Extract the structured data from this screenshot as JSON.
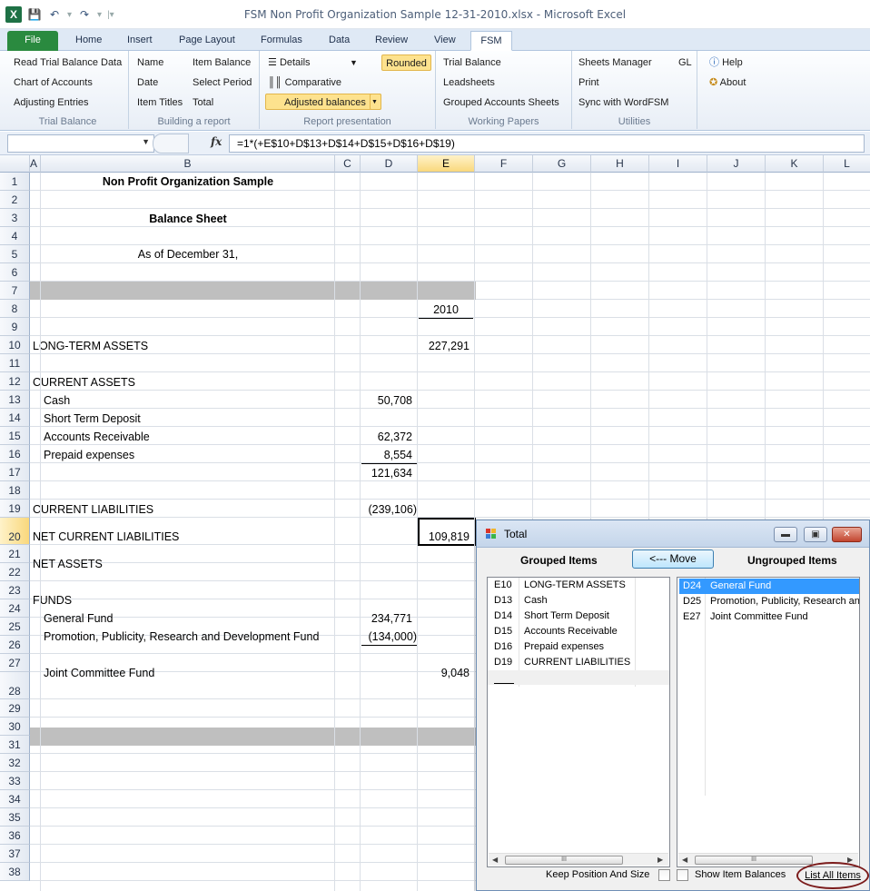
{
  "window": {
    "title": "FSM Non Profit Organization Sample 12-31-2010.xlsx  -  Microsoft Excel",
    "app_icon": "X"
  },
  "qat": {
    "save_icon": "save-icon",
    "undo_icon": "undo-icon",
    "redo_icon": "redo-icon"
  },
  "tabs": [
    "File",
    "Home",
    "Insert",
    "Page Layout",
    "Formulas",
    "Data",
    "Review",
    "View",
    "FSM"
  ],
  "ribbon": {
    "trial_balance": {
      "items": [
        "Read Trial Balance Data",
        "Chart of Accounts",
        "Adjusting Entries"
      ],
      "label": "Trial Balance"
    },
    "building": {
      "col1": [
        "Name",
        "Date",
        "Item Titles"
      ],
      "col2": [
        "Item Balance",
        "Select Period",
        "Total"
      ],
      "label": "Building a report"
    },
    "presentation": {
      "details": "Details",
      "comparative": "Comparative",
      "adjusted": "Adjusted balances",
      "rounded": "Rounded",
      "label": "Report presentation"
    },
    "working": {
      "items": [
        "Trial Balance",
        "Leadsheets",
        "Grouped Accounts Sheets"
      ],
      "label": "Working Papers"
    },
    "utilities": {
      "items": [
        "Sheets Manager",
        "Print",
        "Sync with WordFSM"
      ],
      "gl": "GL",
      "label": "Utilities"
    },
    "help": {
      "help": "Help",
      "about": "About"
    }
  },
  "formula_bar": {
    "name_box": "",
    "fx": "fx",
    "formula": "=1*(+E$10+D$13+D$14+D$15+D$16+D$19)"
  },
  "columns": [
    "A",
    "B",
    "C",
    "D",
    "E",
    "F",
    "G",
    "H",
    "I",
    "J",
    "K",
    "L"
  ],
  "rows": [
    "1",
    "2",
    "3",
    "4",
    "5",
    "6",
    "7",
    "8",
    "9",
    "10",
    "11",
    "12",
    "13",
    "14",
    "15",
    "16",
    "17",
    "18",
    "19",
    "20",
    "21",
    "22",
    "23",
    "24",
    "25",
    "26",
    "27",
    "28",
    "29",
    "30",
    "31",
    "32",
    "33",
    "34",
    "35",
    "36",
    "37",
    "38"
  ],
  "sheet": {
    "title": "Non Profit Organization Sample",
    "subtitle": "Balance Sheet",
    "date_line": "As of December 31,",
    "year": "2010",
    "long_term_assets": "LONG-TERM ASSETS",
    "long_term_assets_value": "227,291",
    "current_assets": "CURRENT ASSETS",
    "cash": "Cash",
    "cash_value": "50,708",
    "short_term_deposit": "Short Term Deposit",
    "accounts_receivable": "Accounts Receivable",
    "accounts_receivable_value": "62,372",
    "prepaid": "Prepaid expenses",
    "prepaid_value": "8,554",
    "current_total": "121,634",
    "current_liabilities": "CURRENT LIABILITIES",
    "current_liabilities_value": "(239,106)",
    "net_current_liabilities": "NET CURRENT LIABILITIES",
    "net_current_liabilities_value": "109,819",
    "net_assets": "NET ASSETS",
    "funds": "FUNDS",
    "general_fund": "General Fund",
    "general_fund_value": "234,771",
    "promotion_fund": "Promotion, Publicity, Research and Development Fund",
    "promotion_fund_value": "(134,000)",
    "joint_fund": "Joint Committee Fund",
    "joint_fund_value": "9,048"
  },
  "dialog": {
    "title": "Total",
    "grouped_label": "Grouped Items",
    "ungrouped_label": "Ungrouped Items",
    "move": "<--- Move",
    "grouped": [
      {
        "ref": "E10",
        "name": "LONG-TERM ASSETS"
      },
      {
        "ref": "D13",
        "name": "Cash"
      },
      {
        "ref": "D14",
        "name": "Short Term Deposit"
      },
      {
        "ref": "D15",
        "name": "Accounts Receivable"
      },
      {
        "ref": "D16",
        "name": "Prepaid expenses"
      },
      {
        "ref": "D19",
        "name": "CURRENT LIABILITIES"
      }
    ],
    "ungrouped": [
      {
        "ref": "D24",
        "name": "General Fund"
      },
      {
        "ref": "D25",
        "name": "Promotion, Publicity, Research and"
      },
      {
        "ref": "E27",
        "name": "Joint Committee Fund"
      }
    ],
    "scroll_thumb": "III",
    "keep_position": "Keep Position And Size",
    "show_balances": "Show Item Balances",
    "list_all": "List All Items",
    "selection_color": "#3399ff"
  }
}
